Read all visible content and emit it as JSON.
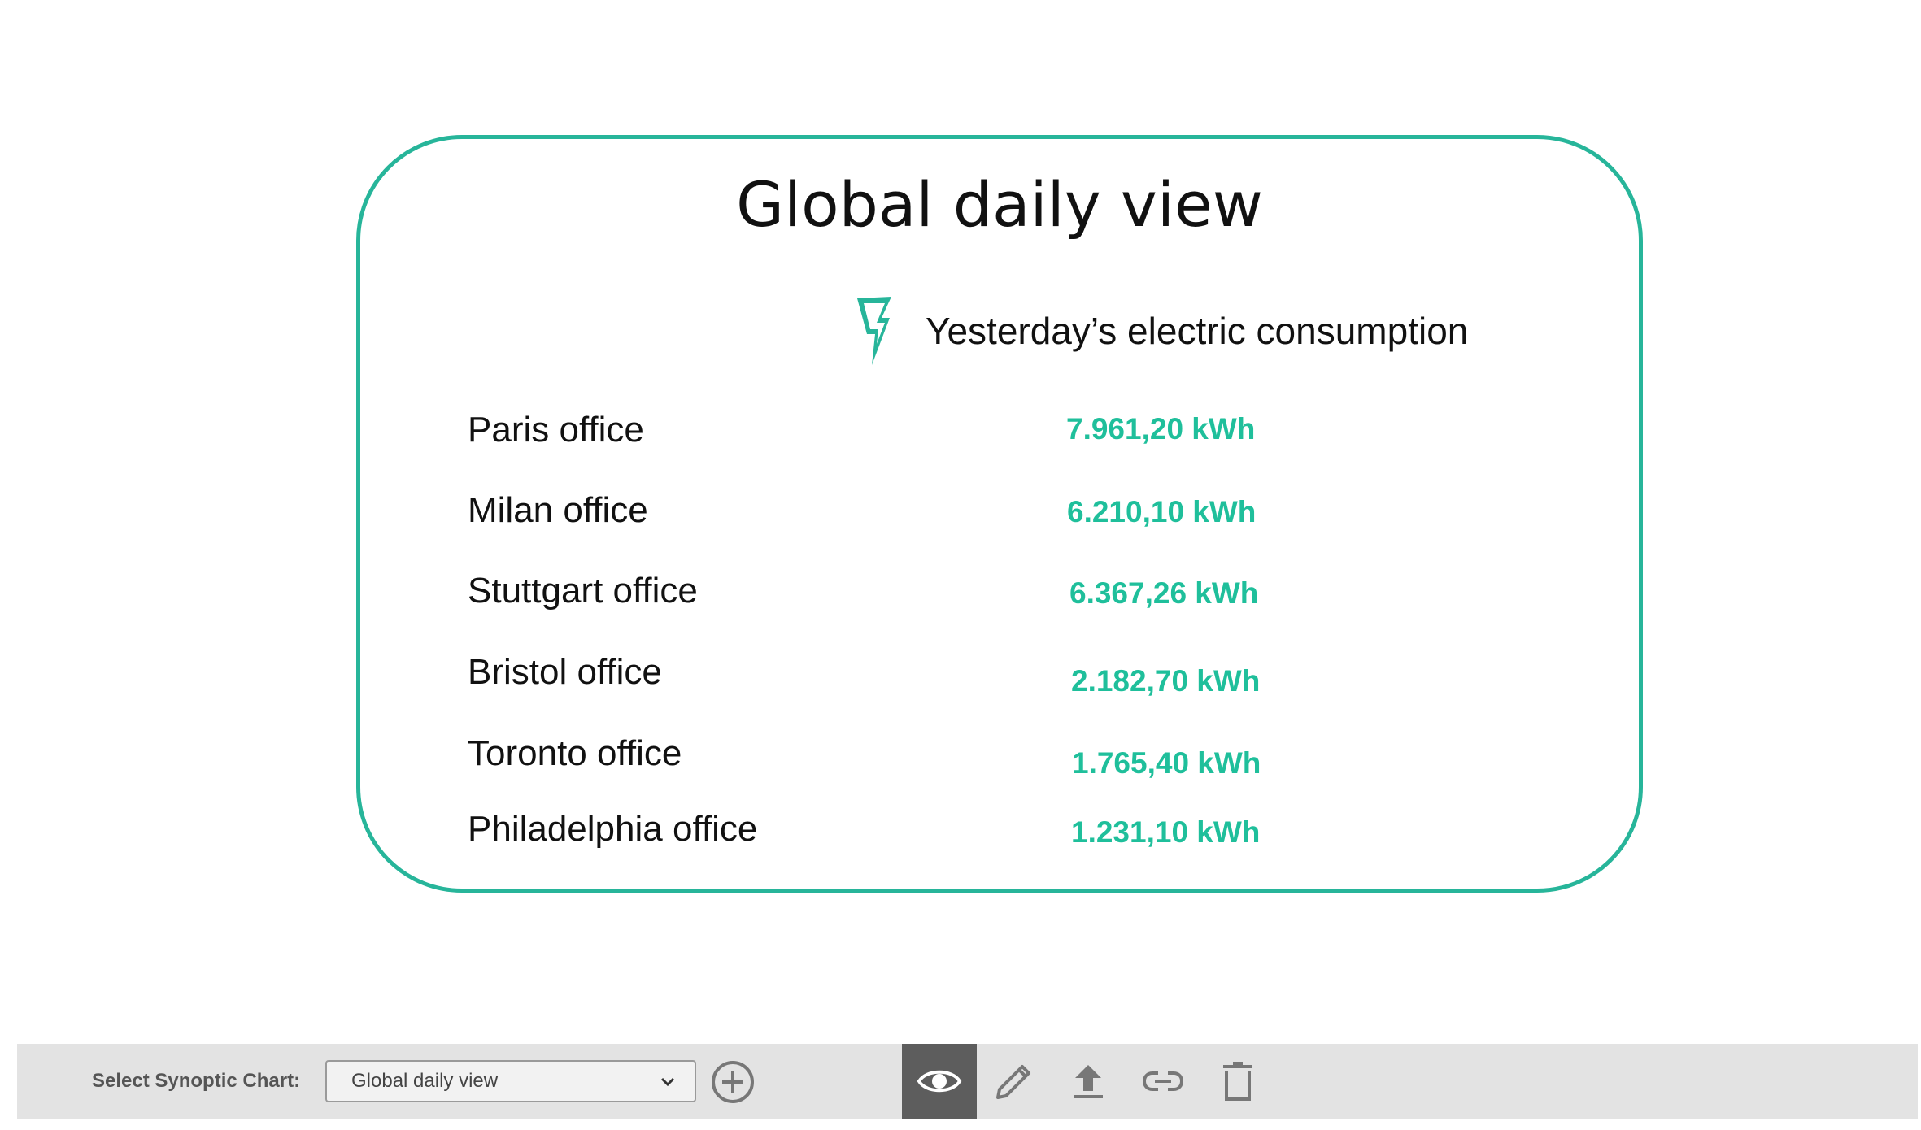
{
  "card": {
    "title": "Global daily view",
    "subtitle": "Yesterday’s electric consumption",
    "icon": "lightning-bolt-icon",
    "accent_color": "#27b59a"
  },
  "offices": [
    {
      "name": "Paris office",
      "value": "7.961,20 kWh"
    },
    {
      "name": "Milan office",
      "value": "6.210,10 kWh"
    },
    {
      "name": "Stuttgart office",
      "value": "6.367,26 kWh"
    },
    {
      "name": "Bristol office",
      "value": "2.182,70 kWh"
    },
    {
      "name": "Toronto office",
      "value": "1.765,40 kWh"
    },
    {
      "name": "Philadelphia office",
      "value": "1.231,10 kWh"
    }
  ],
  "toolbar": {
    "select_label": "Select Synoptic Chart:",
    "selected_chart": "Global daily view",
    "add_icon": "plus-circle-icon",
    "tools": [
      {
        "name": "view",
        "icon": "eye-icon",
        "active": true
      },
      {
        "name": "edit",
        "icon": "pencil-icon",
        "active": false
      },
      {
        "name": "upload",
        "icon": "upload-icon",
        "active": false
      },
      {
        "name": "link",
        "icon": "link-icon",
        "active": false
      },
      {
        "name": "delete",
        "icon": "trash-icon",
        "active": false
      }
    ]
  }
}
